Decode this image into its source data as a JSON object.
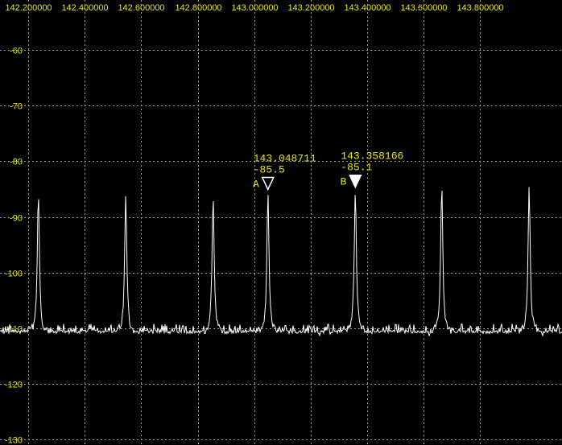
{
  "chart_data": {
    "type": "line",
    "title": "",
    "xlabel": "",
    "ylabel": "",
    "xlim": [
      142.1,
      144.09
    ],
    "ylim": [
      -131,
      -51
    ],
    "x_ticks": [
      "142.200000",
      "142.400000",
      "142.600000",
      "142.800000",
      "143.000000",
      "143.200000",
      "143.400000",
      "143.600000",
      "143.800000"
    ],
    "y_ticks": [
      "-60",
      "-70",
      "-80",
      "-90",
      "-100",
      "-110",
      "-120",
      "-130"
    ],
    "grid": true,
    "noise_floor": -111,
    "series": [
      {
        "peaks": [
          {
            "x": 142.2358,
            "y": -85.5
          },
          {
            "x": 142.5452,
            "y": -86.0
          },
          {
            "x": 142.8546,
            "y": -86.2
          },
          {
            "x": 143.048711,
            "y": -85.5
          },
          {
            "x": 143.358166,
            "y": -85.1
          },
          {
            "x": 143.6642,
            "y": -84.0
          },
          {
            "x": 143.9736,
            "y": -84.3
          }
        ]
      }
    ],
    "markers": [
      {
        "label": "A",
        "freq": "143.048711",
        "level": "-85.5",
        "x": 143.048711,
        "y": -85.5,
        "style": "hollow"
      },
      {
        "label": "B",
        "freq": "143.358166",
        "level": "-85.1",
        "x": 143.358166,
        "y": -85.1,
        "style": "filled"
      }
    ]
  },
  "colors": {
    "background": "#000000",
    "trace": "#ffffff",
    "labels": "#e8e800",
    "grid": "#9a9a9a"
  }
}
